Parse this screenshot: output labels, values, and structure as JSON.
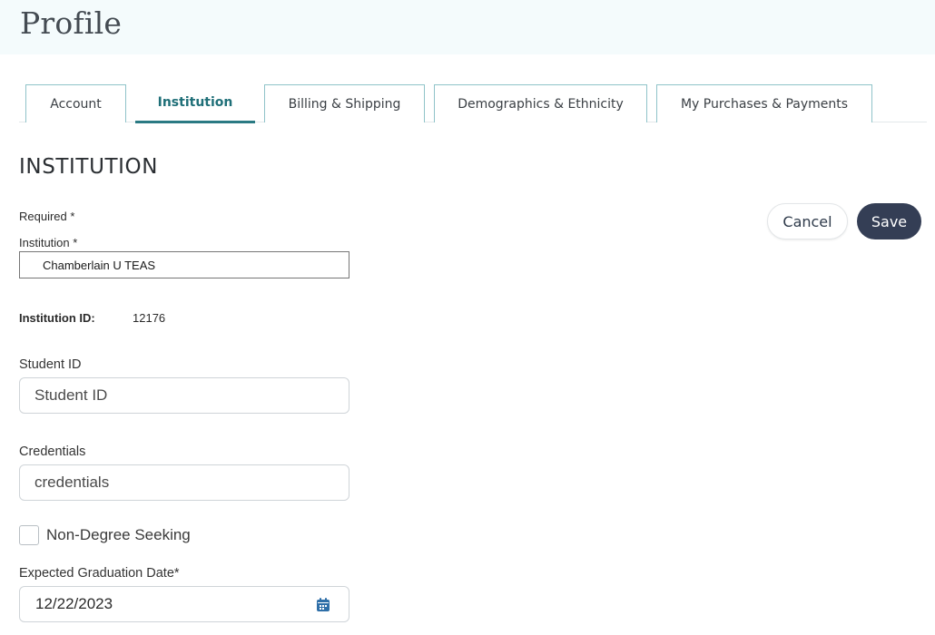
{
  "header": {
    "title": "Profile"
  },
  "tabs": [
    {
      "label": "Account",
      "active": false
    },
    {
      "label": "Institution",
      "active": true
    },
    {
      "label": "Billing & Shipping",
      "active": false
    },
    {
      "label": "Demographics & Ethnicity",
      "active": false
    },
    {
      "label": "My Purchases & Payments",
      "active": false
    }
  ],
  "section": {
    "title": "INSTITUTION"
  },
  "form": {
    "required_note": "Required *",
    "institution": {
      "label": "Institution *",
      "value": "Chamberlain U TEAS"
    },
    "institution_id": {
      "label": "Institution ID:",
      "value": "12176"
    },
    "student_id": {
      "label": "Student ID",
      "placeholder": "Student ID",
      "value": ""
    },
    "credentials": {
      "label": "Credentials",
      "placeholder": "credentials",
      "value": ""
    },
    "non_degree": {
      "label": "Non-Degree Seeking",
      "checked": false
    },
    "graduation": {
      "label": "Expected Graduation Date*",
      "value": "12/22/2023"
    }
  },
  "actions": {
    "cancel_label": "Cancel",
    "save_label": "Save"
  },
  "colors": {
    "accent": "#2a7a83",
    "tab_border": "#8fc3c9",
    "save_bg": "#343e55",
    "header_bg": "#f4fbfc",
    "calendar_icon": "#2f6fa8"
  }
}
